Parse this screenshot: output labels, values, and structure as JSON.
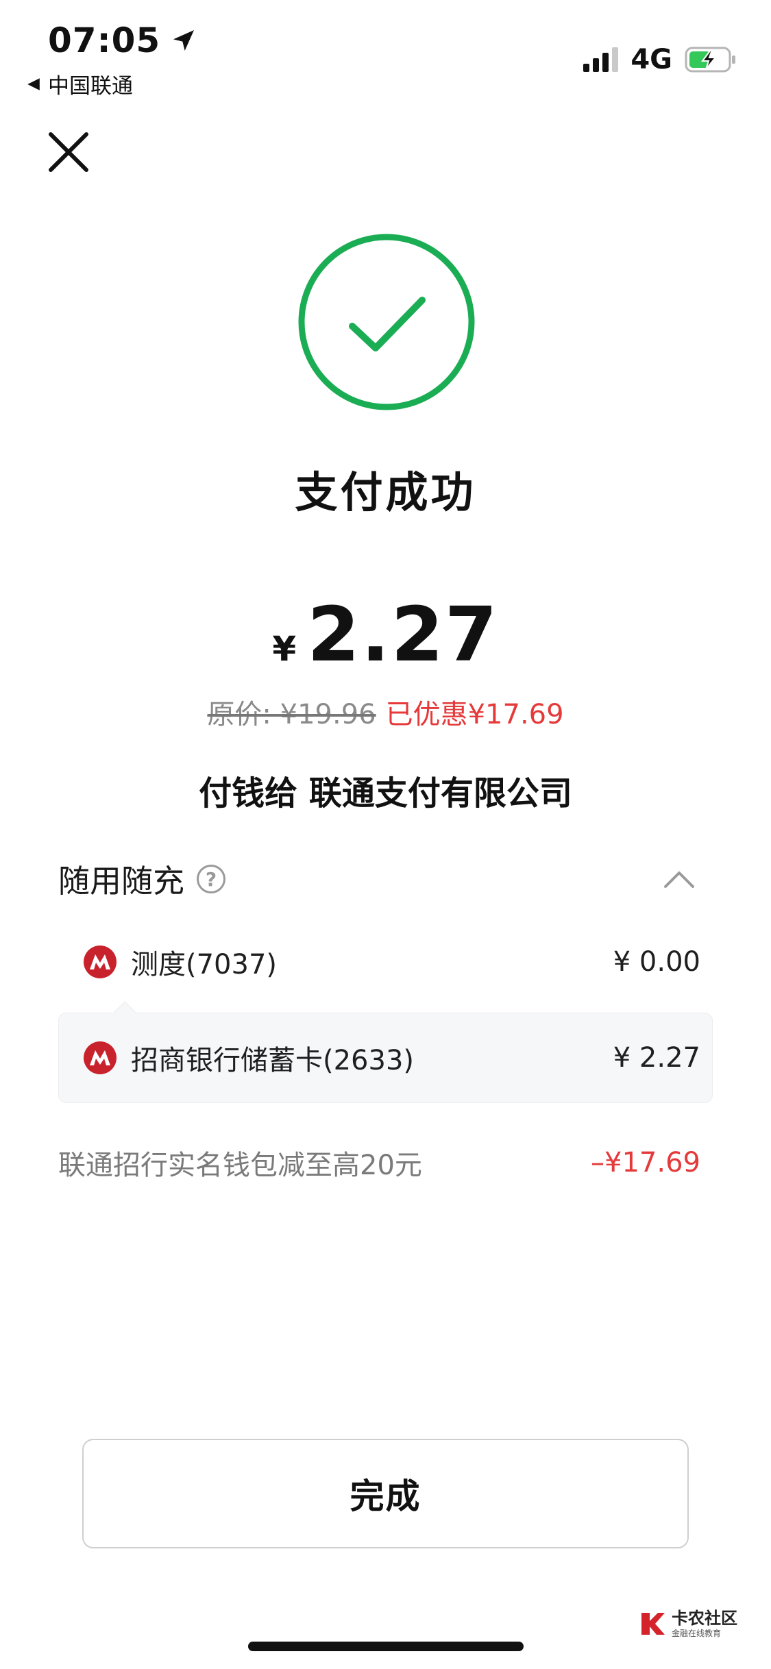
{
  "status_bar": {
    "time": "07:05",
    "carrier": "中国联通",
    "network": "4G",
    "battery_color": "#34c759"
  },
  "icons": {
    "close": "close-icon",
    "success": "check-circle-icon",
    "help": "question-icon",
    "collapse": "chevron-up-icon",
    "bank": "china-merchants-bank-logo"
  },
  "result": {
    "title": "支付成功",
    "currency": "¥",
    "amount": "2.27",
    "original_price": "原价: ¥19.96",
    "discount": "已优惠¥17.69",
    "payee": "付钱给 联通支付有限公司",
    "success_color": "#1aad54",
    "discount_color": "#e5393a"
  },
  "payment": {
    "section_title": "随用随充",
    "help_symbol": "?",
    "methods": [
      {
        "name": "测度(7037)",
        "amount": "¥ 0.00"
      },
      {
        "name": "招商银行储蓄卡(2633)",
        "amount": "¥ 2.27",
        "selected": true
      }
    ],
    "promo": {
      "label": "联通招行实名钱包减至高20元",
      "value": "–¥17.69"
    }
  },
  "actions": {
    "done_label": "完成"
  },
  "watermark": {
    "title": "卡农社区",
    "subtitle": "金融在线教育"
  }
}
